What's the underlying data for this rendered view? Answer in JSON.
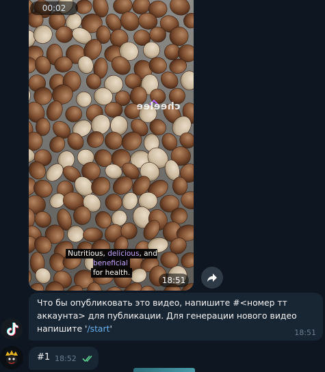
{
  "video_message": {
    "duration": "00:02",
    "watermark": "cheelee",
    "caption": {
      "line1_part1": "Nutritious, ",
      "line1_hl1": "delicious",
      "line1_part2": ", and ",
      "line1_hl2": "beneficial",
      "line2": "for health."
    },
    "time": "18:51"
  },
  "bot_message": {
    "text_before_link": "Что бы опубликовать это видео, напишите #<номер тт аккаунта> для публикации. Для генерации нового видео напишите '",
    "link": "/start",
    "text_after_link": "'",
    "time": "18:51"
  },
  "outgoing_message": {
    "text": "#1",
    "time": "18:52",
    "status": "read"
  },
  "icons": {
    "forward": "forward-arrow-icon",
    "read_status": "double-check-icon",
    "bot_avatar": "tiktok-logo-icon"
  },
  "colors": {
    "background": "#0e1621",
    "bubble": "#182533",
    "link": "#6ab3f3",
    "check": "#5fd38d",
    "caption_highlight": "#c5a2ff"
  }
}
